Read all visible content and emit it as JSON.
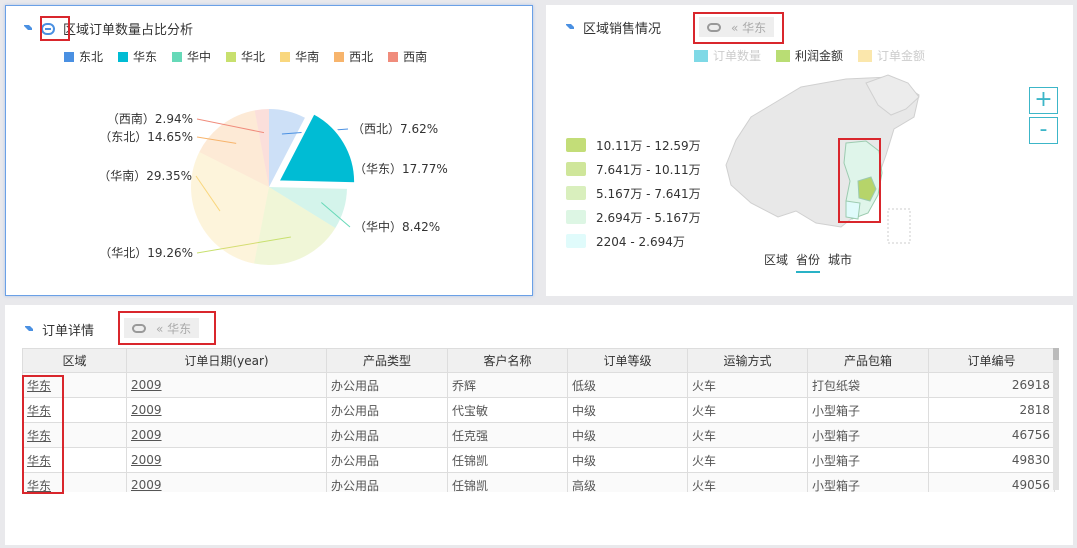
{
  "pie_panel": {
    "title": "区域订单数量占比分析",
    "legend": [
      {
        "name": "东北",
        "color": "#4a90e2"
      },
      {
        "name": "华东",
        "color": "#00bcd4"
      },
      {
        "name": "华中",
        "color": "#66d9b8"
      },
      {
        "name": "华北",
        "color": "#c8e06e"
      },
      {
        "name": "华南",
        "color": "#f9d77e"
      },
      {
        "name": "西北",
        "color": "#f7b46c"
      },
      {
        "name": "西南",
        "color": "#f08c7c"
      }
    ]
  },
  "chart_data": {
    "type": "pie",
    "title": "区域订单数量占比分析",
    "slices": [
      {
        "name": "西北",
        "value": 7.62,
        "label": "（西北）7.62%",
        "color": "#4a90e2"
      },
      {
        "name": "华东",
        "value": 17.77,
        "label": "（华东）17.77%",
        "color": "#00bcd4"
      },
      {
        "name": "华中",
        "value": 8.42,
        "label": "（华中）8.42%",
        "color": "#66d9b8"
      },
      {
        "name": "华北",
        "value": 19.26,
        "label": "（华北）19.26%",
        "color": "#c8e06e"
      },
      {
        "name": "华南",
        "value": 29.35,
        "label": "（华南）29.35%",
        "color": "#f9d77e"
      },
      {
        "name": "东北",
        "value": 14.65,
        "label": "（东北）14.65%",
        "color": "#f7b46c"
      },
      {
        "name": "西南",
        "value": 2.94,
        "label": "（西南）2.94%",
        "color": "#f08c7c"
      }
    ],
    "highlighted": "华东"
  },
  "map_panel": {
    "title": "区域销售情况",
    "drill_label": "« 华东",
    "legend": [
      {
        "name": "订单数量",
        "color": "#7fd9e6",
        "active": false
      },
      {
        "name": "利润金额",
        "color": "#b9dd74",
        "active": true
      },
      {
        "name": "订单金额",
        "color": "#fbe7ac",
        "active": false
      }
    ],
    "zoom_in": "+",
    "zoom_out": "-",
    "visual_map": [
      {
        "label": "10.11万 - 12.59万",
        "color": "#c3dd78"
      },
      {
        "label": "7.641万 - 10.11万",
        "color": "#cfe69a"
      },
      {
        "label": "5.167万 - 7.641万",
        "color": "#d9efbd"
      },
      {
        "label": "2.694万 - 5.167万",
        "color": "#ddf6e4"
      },
      {
        "label": "2204 - 2.694万",
        "color": "#e0fbfb"
      }
    ],
    "tabs": [
      "区域",
      "省份",
      "城市"
    ],
    "active_tab": "省份"
  },
  "table_panel": {
    "title": "订单详情",
    "drill_label": "« 华东",
    "columns": [
      "区域",
      "订单日期(year)",
      "产品类型",
      "客户名称",
      "订单等级",
      "运输方式",
      "产品包箱",
      "订单编号"
    ],
    "rows": [
      [
        "华东",
        "2009",
        "办公用品",
        "乔辉",
        "低级",
        "火车",
        "打包纸袋",
        "26918"
      ],
      [
        "华东",
        "2009",
        "办公用品",
        "代宝敏",
        "中级",
        "火车",
        "小型箱子",
        "2818"
      ],
      [
        "华东",
        "2009",
        "办公用品",
        "任克强",
        "中级",
        "火车",
        "小型箱子",
        "46756"
      ],
      [
        "华东",
        "2009",
        "办公用品",
        "任锦凯",
        "中级",
        "火车",
        "小型箱子",
        "49830"
      ],
      [
        "华东",
        "2009",
        "办公用品",
        "任锦凯",
        "高级",
        "火车",
        "小型箱子",
        "49056"
      ]
    ]
  }
}
